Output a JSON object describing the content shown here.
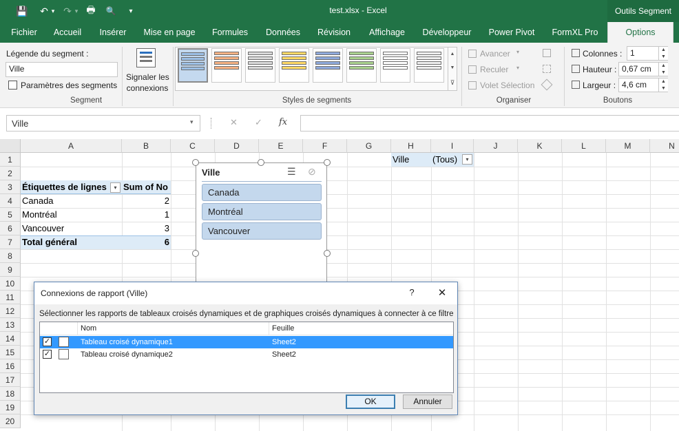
{
  "window": {
    "title": "test.xlsx - Excel",
    "contextual_group": "Outils Segment",
    "qat": {
      "save_icon": "💾",
      "undo_icon": "↶",
      "undo_dd": "▾",
      "redo_icon": "↷",
      "redo_dd": "▾",
      "print_icon": "🖶",
      "preview_icon": "🔍",
      "customize_icon": "▾"
    }
  },
  "ribbon_tabs": [
    "Fichier",
    "Accueil",
    "Insérer",
    "Mise en page",
    "Formules",
    "Données",
    "Révision",
    "Affichage",
    "Développeur",
    "Power Pivot",
    "FormXL Pro",
    "Options"
  ],
  "ribbon": {
    "segment": {
      "caption_label": "Légende du segment :",
      "caption_value": "Ville",
      "settings_label": "Paramètres des segments",
      "group_label": "Segment"
    },
    "report_connections_label": [
      "Signaler les",
      "connexions"
    ],
    "styles_group_label": "Styles de segments",
    "organize": {
      "bring_forward": "Avancer",
      "send_backward": "Reculer",
      "selection_pane": "Volet Sélection",
      "group_label": "Organiser"
    },
    "buttons": {
      "columns_label": "Colonnes :",
      "columns_value": "1",
      "height_label": "Hauteur :",
      "height_value": "0,67 cm",
      "width_label": "Largeur :",
      "width_value": "4,6 cm",
      "group_label": "Boutons"
    },
    "spin_up": "▲",
    "spin_down": "▼",
    "gallery_up": "▲",
    "gallery_down": "▼",
    "gallery_more": "⊽"
  },
  "formula_bar": {
    "name_box": "Ville",
    "name_dd": "▾",
    "cancel": "✕",
    "enter": "✓",
    "fx": "fx",
    "formula": ""
  },
  "columns": [
    "A",
    "B",
    "C",
    "D",
    "E",
    "F",
    "G",
    "H",
    "I",
    "J",
    "K",
    "L",
    "M",
    "N"
  ],
  "rows": [
    "1",
    "2",
    "3",
    "4",
    "5",
    "6",
    "7",
    "8",
    "9",
    "10",
    "11",
    "12",
    "13",
    "14",
    "15",
    "16",
    "17",
    "18",
    "19",
    "20"
  ],
  "pivot": {
    "header_labels": "Étiquettes de lignes",
    "header_sum": "Sum of No",
    "filter_dd": "▾",
    "rows": [
      {
        "label": "Canada",
        "value": "2"
      },
      {
        "label": "Montréal",
        "value": "1"
      },
      {
        "label": "Vancouver",
        "value": "3"
      }
    ],
    "total_label": "Total général",
    "total_value": "6"
  },
  "filter": {
    "field": "Ville",
    "value": "(Tous)",
    "dd": "▾"
  },
  "slicer": {
    "title": "Ville",
    "multiselect_icon": "☰",
    "clear_filter_icon": "⊘",
    "items": [
      "Canada",
      "Montréal",
      "Vancouver"
    ]
  },
  "dialog": {
    "title": "Connexions de rapport (Ville)",
    "help": "?",
    "close": "✕",
    "description": "Sélectionner les rapports de tableaux croisés dynamiques et de graphiques croisés dynamiques à connecter à ce filtre",
    "columns": {
      "name": "Nom",
      "sheet": "Feuille"
    },
    "items": [
      {
        "name": "Tableau croisé dynamique1",
        "sheet": "Sheet2",
        "checked": "✓"
      },
      {
        "name": "Tableau croisé dynamique2",
        "sheet": "Sheet2",
        "checked": "✓"
      }
    ],
    "ok": "OK",
    "cancel": "Annuler"
  },
  "colors": {
    "brand": "#217346",
    "pivot_highlight": "#ddebf7",
    "slicer_item": "#c4d8ed",
    "list_selection": "#3399ff"
  }
}
